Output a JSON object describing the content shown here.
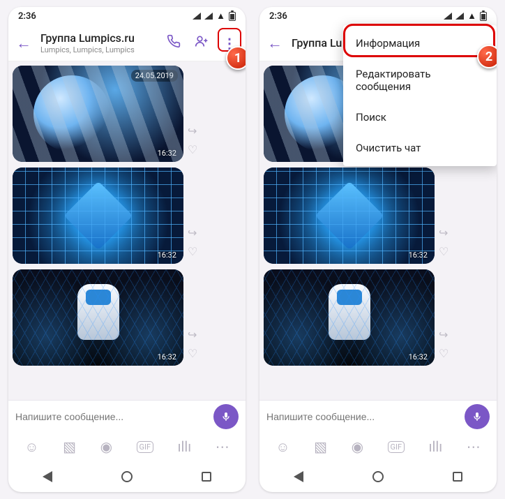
{
  "status": {
    "time": "2:36"
  },
  "header": {
    "title": "Группа Lumpics.ru",
    "subtitle": "Lumpics, Lumpics, Lumpics"
  },
  "messages": {
    "date_label": "24.05.2019",
    "time1": "16:32",
    "time2": "16:32",
    "time3": "16:32"
  },
  "input": {
    "placeholder": "Напишите сообщение..."
  },
  "menu": {
    "info": "Информация",
    "edit": "Редактировать сообщения",
    "search": "Поиск",
    "clear": "Очистить чат"
  },
  "header2": {
    "title_clip": "Группа Lu"
  },
  "badges": {
    "step1": "1",
    "step2": "2"
  }
}
